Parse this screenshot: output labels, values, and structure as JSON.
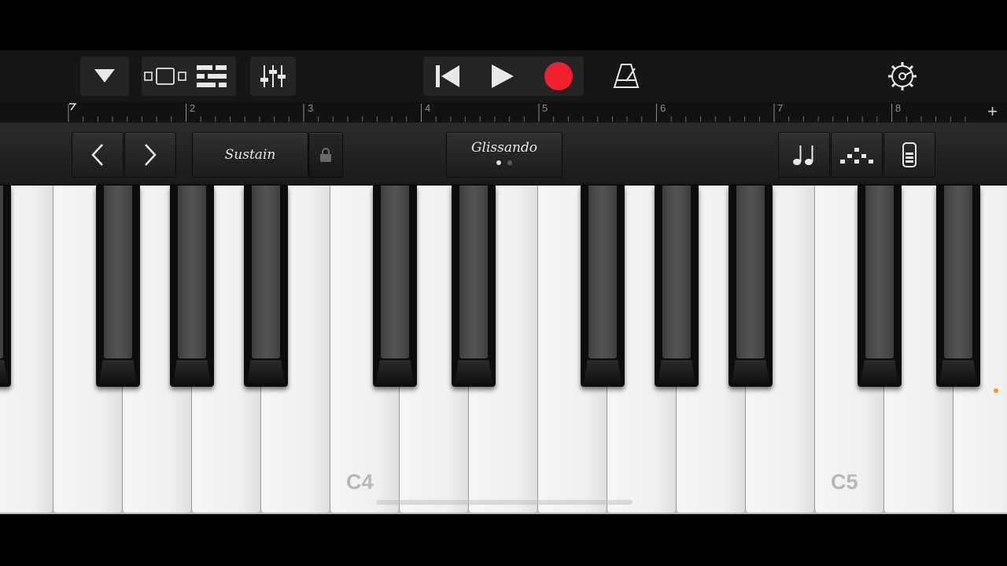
{
  "toolbar": {
    "icons": [
      "dropdown-triangle-icon",
      "browser-view-icon",
      "tracks-view-icon",
      "mixer-icon",
      "rewind-icon",
      "play-icon",
      "record-icon",
      "metronome-icon",
      "settings-icon"
    ],
    "record_color": "#f0202c"
  },
  "ruler": {
    "bars": [
      "2",
      "3",
      "4",
      "5",
      "6",
      "7",
      "8"
    ],
    "add_label": "+"
  },
  "controls": {
    "prev_label": "<",
    "next_label": ">",
    "sustain_label": "Sustain",
    "glissando_label": "Glissando",
    "icons": [
      "lock-icon",
      "notes-icon",
      "arpeggiator-icon",
      "velocity-icon"
    ]
  },
  "keyboard": {
    "labels": [
      "C4",
      "C5"
    ]
  }
}
